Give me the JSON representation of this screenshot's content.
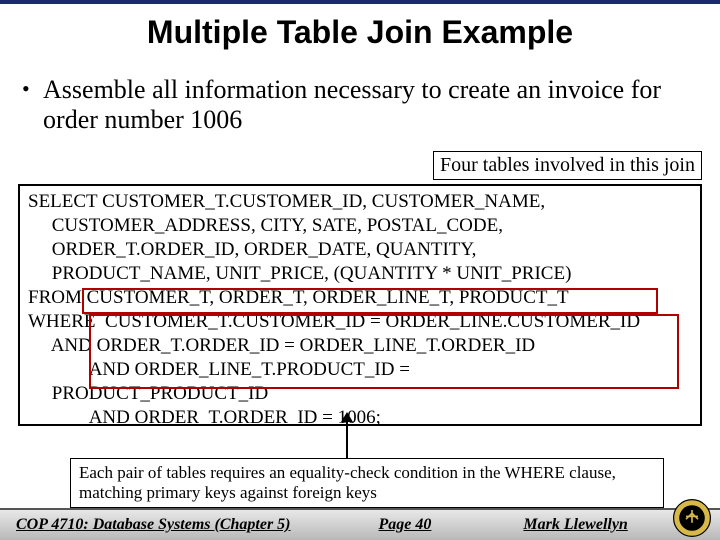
{
  "title": "Multiple Table Join Example",
  "bullet": "Assemble all information necessary to create an invoice for order number 1006",
  "callout_top": "Four tables involved in this join",
  "sql": "SELECT CUSTOMER_T.CUSTOMER_ID, CUSTOMER_NAME,\n     CUSTOMER_ADDRESS, CITY, SATE, POSTAL_CODE,\n     ORDER_T.ORDER_ID, ORDER_DATE, QUANTITY,\n     PRODUCT_NAME, UNIT_PRICE, (QUANTITY * UNIT_PRICE)\nFROM CUSTOMER_T, ORDER_T, ORDER_LINE_T, PRODUCT_T\nWHERE  CUSTOMER_T.CUSTOMER_ID = ORDER_LINE.CUSTOMER_ID\n     AND ORDER_T.ORDER_ID = ORDER_LINE_T.ORDER_ID\n             AND ORDER_LINE_T.PRODUCT_ID =\n     PRODUCT_PRODUCT_ID\n             AND ORDER_T.ORDER_ID = 1006;",
  "callout_bottom": "Each pair of tables requires an equality-check condition in the WHERE clause, matching primary keys against foreign keys",
  "footer": {
    "course": "COP 4710: Database Systems  (Chapter 5)",
    "page": "Page 40",
    "author": "Mark Llewellyn"
  }
}
